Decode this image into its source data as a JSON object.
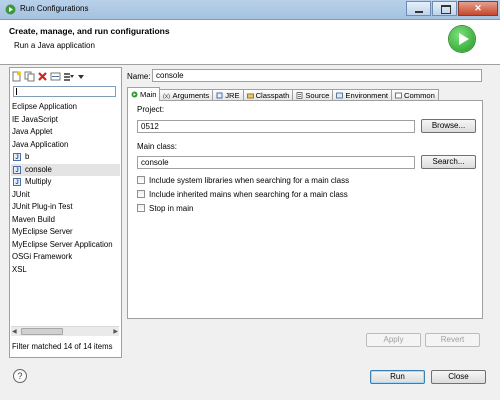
{
  "window": {
    "title": "Run Configurations"
  },
  "header": {
    "title": "Create, manage, and run configurations",
    "subtitle": "Run a Java application"
  },
  "left_pane": {
    "filter_value": "",
    "items": [
      {
        "label": "Eclipse Application",
        "icon": "none"
      },
      {
        "label": "IE JavaScript",
        "icon": "none"
      },
      {
        "label": "Java Applet",
        "icon": "none"
      },
      {
        "label": "Java Application",
        "icon": "none"
      },
      {
        "label": "b",
        "icon": "java-class-icon"
      },
      {
        "label": "console",
        "icon": "java-class-icon",
        "selected": true
      },
      {
        "label": "Multiply",
        "icon": "java-class-icon"
      },
      {
        "label": "JUnit",
        "icon": "none"
      },
      {
        "label": "JUnit Plug-in Test",
        "icon": "none"
      },
      {
        "label": "Maven Build",
        "icon": "none"
      },
      {
        "label": "MyEclipse Server",
        "icon": "none"
      },
      {
        "label": "MyEclipse Server Application",
        "icon": "none"
      },
      {
        "label": "OSGi Framework",
        "icon": "none"
      },
      {
        "label": "XSL",
        "icon": "none"
      }
    ],
    "status": "Filter matched 14 of 14 items"
  },
  "config": {
    "name_label": "Name:",
    "name_value": "console",
    "tabs": [
      {
        "label": "Main",
        "icon": "main-tab-icon",
        "active": true
      },
      {
        "label": "Arguments",
        "icon": "arguments-tab-icon"
      },
      {
        "label": "JRE",
        "icon": "jre-tab-icon"
      },
      {
        "label": "Classpath",
        "icon": "classpath-tab-icon"
      },
      {
        "label": "Source",
        "icon": "source-tab-icon"
      },
      {
        "label": "Environment",
        "icon": "environment-tab-icon"
      },
      {
        "label": "Common",
        "icon": "common-tab-icon"
      }
    ],
    "project_label": "Project:",
    "project_value": "0512",
    "browse_label": "Browse...",
    "main_class_label": "Main class:",
    "main_class_value": "console",
    "search_label": "Search...",
    "checkboxes": [
      {
        "label": "Include system libraries when searching for a main class",
        "checked": false
      },
      {
        "label": "Include inherited mains when searching for a main class",
        "checked": false
      },
      {
        "label": "Stop in main",
        "checked": false
      }
    ],
    "apply_label": "Apply",
    "revert_label": "Revert"
  },
  "footer": {
    "run_label": "Run",
    "close_label": "Close"
  },
  "colors": {
    "title_bar": "#b9d1ea",
    "run_green": "#1f9b1f",
    "selection": "#e4e4e4"
  }
}
